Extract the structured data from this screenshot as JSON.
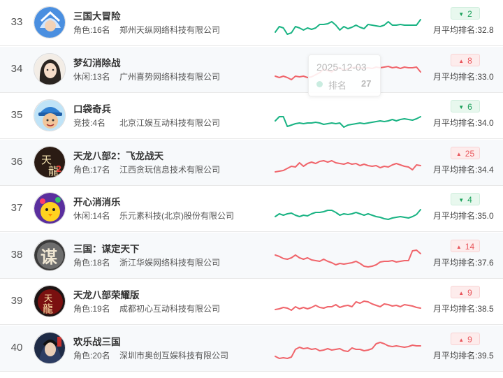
{
  "colors": {
    "green": "#19b383",
    "red": "#f0656b"
  },
  "tooltip": {
    "date": "2025-12-03",
    "label": "排名",
    "value": "27"
  },
  "rows": [
    {
      "rank": "33",
      "name": "三国大冒险",
      "category": "角色:16名",
      "company": "郑州天纵网络科技有限公司",
      "trend": "down",
      "change": "2",
      "avg": "月平均排名:32.8",
      "icon": "hero-helmet-icon",
      "spark": [
        30,
        22,
        24,
        33,
        31,
        22,
        24,
        27,
        24,
        26,
        24,
        19,
        19,
        18,
        15,
        20,
        27,
        22,
        25,
        23,
        20,
        23,
        25,
        19,
        20,
        21,
        22,
        20,
        15,
        20,
        20,
        19,
        20,
        20,
        20,
        20,
        12
      ]
    },
    {
      "rank": "34",
      "name": "梦幻消除战",
      "category": "休闲:13名",
      "company": "广州喜势网络科技有限公司",
      "trend": "up",
      "change": "8",
      "avg": "月平均排名:33.0",
      "icon": "lady-portrait-icon",
      "spark": [
        26,
        28,
        26,
        28,
        31,
        26,
        27,
        26,
        28,
        27,
        24,
        21,
        16,
        18,
        20,
        15,
        14,
        18,
        15,
        14,
        13,
        14,
        15,
        14,
        15,
        13,
        14,
        13,
        12,
        14,
        13,
        15,
        13,
        14,
        14,
        13,
        20
      ]
    },
    {
      "rank": "35",
      "name": "口袋奇兵",
      "category": "竞技:4名",
      "company": "北京江娱互动科技有限公司",
      "trend": "down",
      "change": "6",
      "avg": "月平均排名:34.0",
      "icon": "soldier-cap-icon",
      "spark": [
        24,
        18,
        18,
        32,
        30,
        28,
        27,
        28,
        27,
        27,
        26,
        27,
        29,
        28,
        27,
        28,
        27,
        33,
        30,
        29,
        28,
        27,
        28,
        27,
        26,
        25,
        24,
        25,
        24,
        22,
        24,
        22,
        21,
        22,
        23,
        21,
        18
      ]
    },
    {
      "rank": "36",
      "name": "天龙八部2：飞龙战天",
      "category": "角色:17名",
      "company": "江西贪玩信息技术有限公司",
      "trend": "up",
      "change": "25",
      "avg": "月平均排名:34.4",
      "icon": "dragon-calligraphy-icon",
      "spark": [
        30,
        29,
        28,
        25,
        22,
        23,
        17,
        22,
        18,
        16,
        18,
        15,
        14,
        16,
        14,
        17,
        18,
        19,
        17,
        19,
        18,
        21,
        19,
        21,
        22,
        21,
        24,
        22,
        23,
        20,
        18,
        20,
        22,
        23,
        27,
        20,
        21
      ]
    },
    {
      "rank": "37",
      "name": "开心消消乐",
      "category": "休闲:14名",
      "company": "乐元素科技(北京)股份有限公司",
      "trend": "down",
      "change": "4",
      "avg": "月平均排名:35.0",
      "icon": "yellow-chick-icon",
      "spark": [
        28,
        24,
        26,
        24,
        23,
        26,
        28,
        26,
        27,
        24,
        22,
        22,
        21,
        19,
        19,
        22,
        26,
        24,
        25,
        24,
        22,
        24,
        26,
        24,
        26,
        28,
        29,
        31,
        32,
        30,
        29,
        28,
        29,
        30,
        28,
        25,
        18
      ]
    },
    {
      "rank": "38",
      "name": "三国：谋定天下",
      "category": "角色:18名",
      "company": "浙江华娱网络科技有限公司",
      "trend": "up",
      "change": "14",
      "avg": "月平均排名:37.6",
      "icon": "strategy-calligraphy-icon",
      "spark": [
        16,
        18,
        21,
        22,
        20,
        16,
        20,
        22,
        20,
        23,
        24,
        25,
        22,
        25,
        27,
        30,
        28,
        29,
        28,
        27,
        25,
        28,
        32,
        33,
        32,
        30,
        26,
        25,
        25,
        24,
        26,
        25,
        24,
        24,
        10,
        9,
        14
      ]
    },
    {
      "rank": "39",
      "name": "天龙八部荣耀版",
      "category": "角色:19名",
      "company": "成都初心互动科技有限公司",
      "trend": "up",
      "change": "9",
      "avg": "月平均排名:38.5",
      "icon": "dragon-emblem-icon",
      "spark": [
        28,
        27,
        25,
        26,
        29,
        24,
        27,
        25,
        27,
        25,
        22,
        25,
        26,
        24,
        24,
        21,
        25,
        23,
        22,
        24,
        17,
        19,
        16,
        17,
        20,
        22,
        24,
        20,
        21,
        23,
        22,
        24,
        21,
        22,
        23,
        25,
        26
      ]
    },
    {
      "rank": "40",
      "name": "欢乐战三国",
      "category": "角色:20名",
      "company": "深圳市奥创互娱科技有限公司",
      "trend": "up",
      "change": "9",
      "avg": "月平均排名:39.5",
      "icon": "warrior-portrait-icon",
      "spark": [
        28,
        31,
        30,
        31,
        29,
        18,
        15,
        17,
        16,
        18,
        17,
        20,
        19,
        17,
        19,
        18,
        17,
        20,
        21,
        16,
        18,
        18,
        20,
        19,
        17,
        10,
        8,
        10,
        13,
        14,
        13,
        14,
        15,
        14,
        12,
        13,
        13
      ]
    }
  ]
}
